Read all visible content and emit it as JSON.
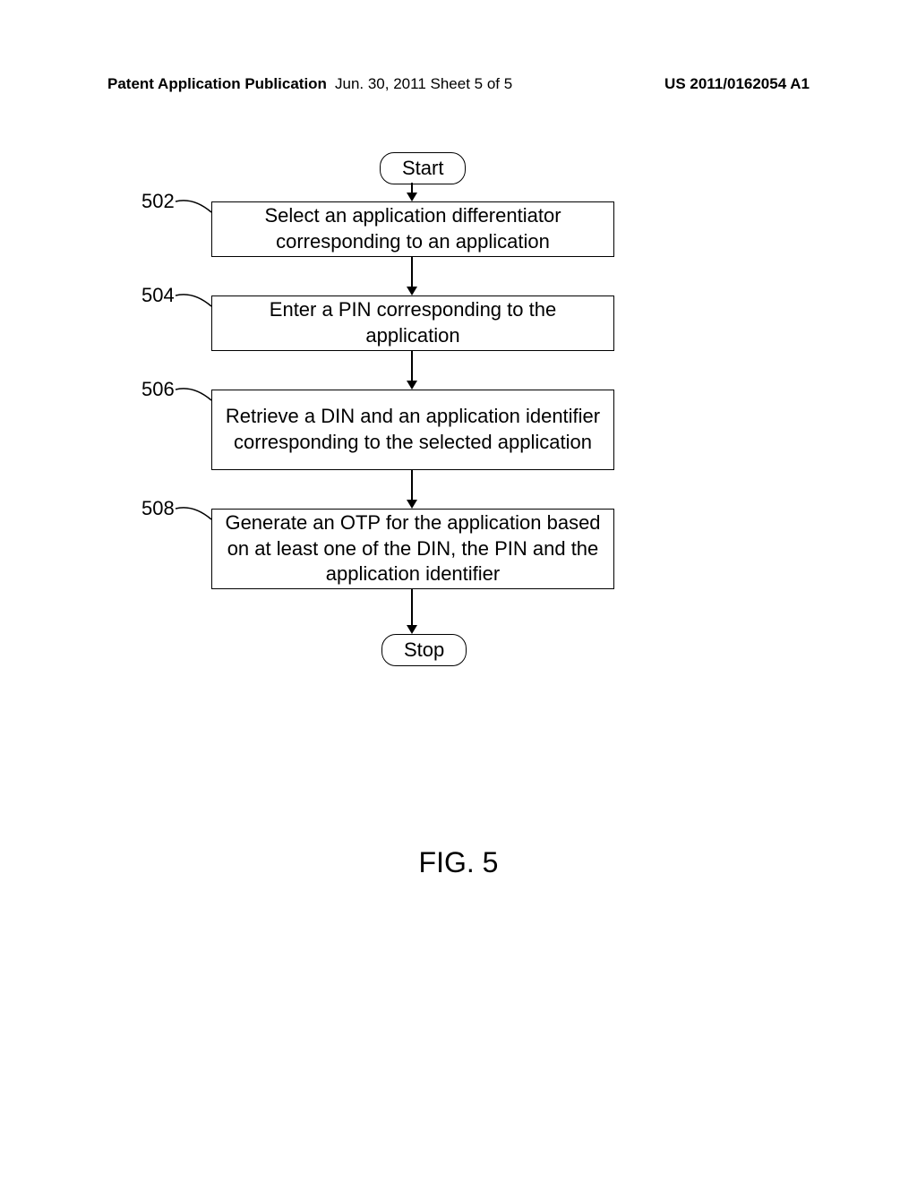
{
  "header": {
    "left": "Patent Application Publication",
    "center": "Jun. 30, 2011  Sheet 5 of 5",
    "right": "US 2011/0162054 A1"
  },
  "flow": {
    "start": "Start",
    "stop": "Stop",
    "steps": [
      {
        "ref": "502",
        "text": "Select an application differentiator corresponding to  an application"
      },
      {
        "ref": "504",
        "text": "Enter a PIN corresponding to the application"
      },
      {
        "ref": "506",
        "text": "Retrieve a DIN and an application identifier corresponding to the selected application"
      },
      {
        "ref": "508",
        "text": "Generate an OTP for the application based on at least one of the DIN, the PIN and the application identifier"
      }
    ]
  },
  "figure_label": "FIG. 5"
}
